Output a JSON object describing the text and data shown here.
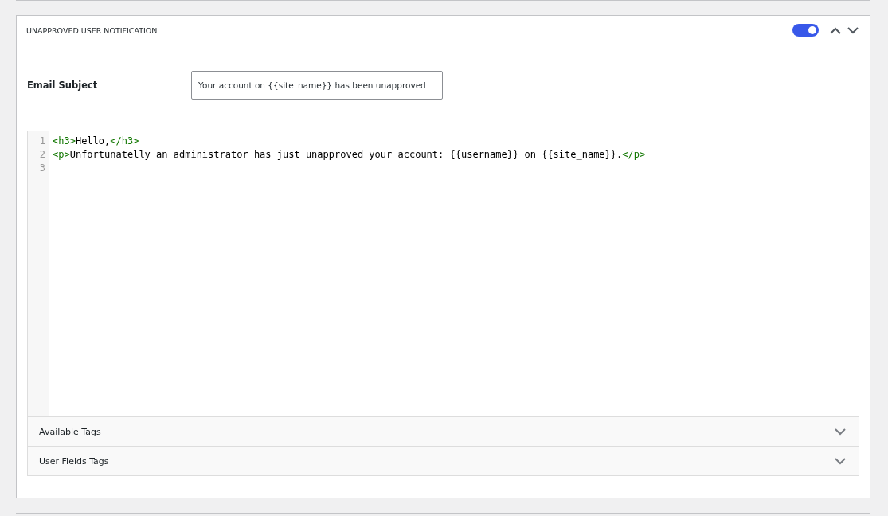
{
  "panel": {
    "title": "UNAPPROVED USER NOTIFICATION",
    "enabled": {
      "on": true
    }
  },
  "email_subject": {
    "label": "Email Subject",
    "value": "Your account on {{site_name}} has been unapproved"
  },
  "editor": {
    "lines": [
      {
        "number": "1",
        "segments": [
          {
            "kind": "tag",
            "text": "<h3>"
          },
          {
            "kind": "text",
            "text": "Hello,"
          },
          {
            "kind": "tag",
            "text": "</h3>"
          }
        ]
      },
      {
        "number": "2",
        "segments": [
          {
            "kind": "tag",
            "text": "<p>"
          },
          {
            "kind": "text",
            "text": "Unfortunatelly an administrator has just unapproved your account: {{username}} on {{site_name}}."
          },
          {
            "kind": "tag",
            "text": "</p>"
          }
        ]
      },
      {
        "number": "3"
      }
    ]
  },
  "accordions": [
    {
      "label": "Available Tags",
      "expanded": false
    },
    {
      "label": "User Fields Tags",
      "expanded": false
    }
  ]
}
